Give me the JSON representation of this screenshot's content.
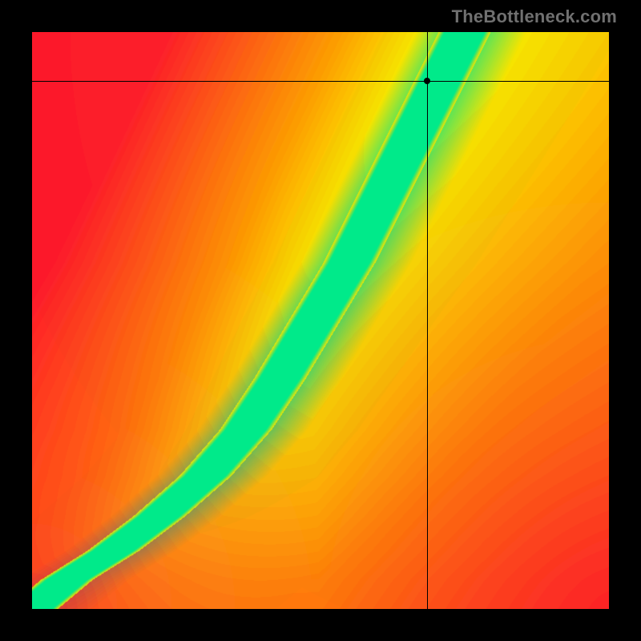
{
  "watermark": "TheBottleneck.com",
  "chart_data": {
    "type": "heatmap",
    "title": "",
    "xlabel": "",
    "ylabel": "",
    "xlim": [
      0,
      1
    ],
    "ylim": [
      0,
      1
    ],
    "marker": {
      "x": 0.685,
      "y": 0.915
    },
    "crosshair": {
      "x": 0.685,
      "y": 0.915
    },
    "optimal_curve": [
      {
        "x": 0.0,
        "y": 0.0
      },
      {
        "x": 0.06,
        "y": 0.05
      },
      {
        "x": 0.14,
        "y": 0.1
      },
      {
        "x": 0.22,
        "y": 0.16
      },
      {
        "x": 0.3,
        "y": 0.23
      },
      {
        "x": 0.37,
        "y": 0.31
      },
      {
        "x": 0.43,
        "y": 0.4
      },
      {
        "x": 0.49,
        "y": 0.5
      },
      {
        "x": 0.55,
        "y": 0.6
      },
      {
        "x": 0.6,
        "y": 0.7
      },
      {
        "x": 0.65,
        "y": 0.8
      },
      {
        "x": 0.7,
        "y": 0.9
      },
      {
        "x": 0.75,
        "y": 1.0
      }
    ],
    "color_stops": {
      "good": "#00e88a",
      "warn": "#f5e300",
      "mid": "#ff9a00",
      "bad": "#ff1a2a"
    },
    "band_half_width": 0.045,
    "grid": false,
    "legend": false
  }
}
